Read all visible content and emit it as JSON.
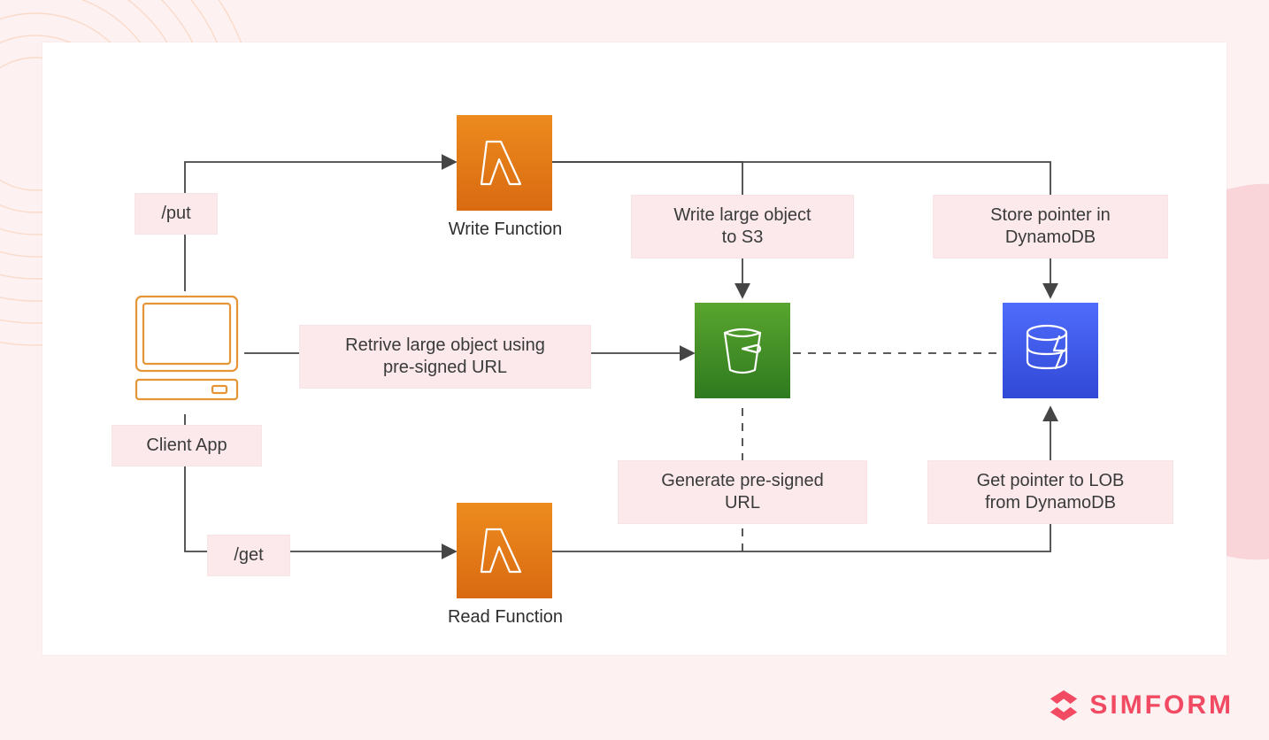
{
  "nodes": {
    "client": {
      "label": "Client App"
    },
    "writeLambda": {
      "label": "Write Function"
    },
    "readLambda": {
      "label": "Read Function"
    },
    "s3": {
      "label": ""
    },
    "dynamo": {
      "label": ""
    }
  },
  "labels": {
    "put": "/put",
    "get": "/get",
    "retrieve": "Retrive large object using\npre-signed URL",
    "writeObj": "Write large object\nto S3",
    "storePtr": "Store pointer in\nDynamoDB",
    "genUrl": "Generate pre-signed\nURL",
    "getPtr": "Get pointer to LOB\nfrom DynamoDB"
  },
  "brand": {
    "name": "SIMFORM"
  },
  "colors": {
    "bg": "#fdf1f2",
    "pill": "#fbe9ec",
    "lambda": "#ed8b1e",
    "s3": "#2f7a1f",
    "dynamo": "#3148d6",
    "brand": "#f14a62"
  }
}
